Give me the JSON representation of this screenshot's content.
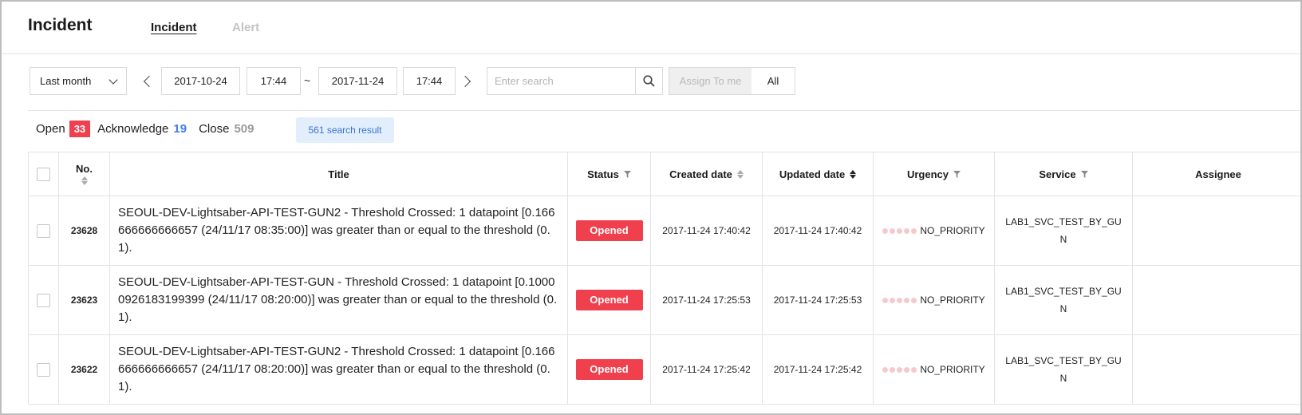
{
  "header": {
    "app_title": "Incident",
    "tabs": [
      {
        "label": "Incident",
        "active": true
      },
      {
        "label": "Alert",
        "active": false
      }
    ]
  },
  "filters": {
    "range": "Last month",
    "start_date": "2017-10-24",
    "start_time": "17:44",
    "separator": "~",
    "end_date": "2017-11-24",
    "end_time": "17:44",
    "search_placeholder": "Enter search",
    "assign_label": "Assign To me",
    "all_label": "All"
  },
  "counts": {
    "open_label": "Open",
    "open_value": "33",
    "ack_label": "Acknowledge",
    "ack_value": "19",
    "close_label": "Close",
    "close_value": "509",
    "result": "561 search result"
  },
  "colors": {
    "open_badge": "#f0404e",
    "ack_value": "#3f7ee8",
    "result_pill_bg": "#e2eefc",
    "status_opened": "#f0404e",
    "urgency_dot": "#f6c9cd"
  },
  "table": {
    "columns": {
      "no": "No.",
      "title": "Title",
      "status": "Status",
      "created": "Created date",
      "updated": "Updated date",
      "urgency": "Urgency",
      "service": "Service",
      "assignee": "Assignee"
    },
    "rows": [
      {
        "no": "23628",
        "title": "SEOUL-DEV-Lightsaber-API-TEST-GUN2 - Threshold Crossed: 1 datapoint [0.166666666666657 (24/11/17 08:35:00)] was greater than or equal to the threshold (0.1).",
        "status": "Opened",
        "created": "2017-11-24 17:40:42",
        "updated": "2017-11-24 17:40:42",
        "urgency": "NO_PRIORITY",
        "service": "LAB1_SVC_TEST_BY_GUN",
        "assignee": ""
      },
      {
        "no": "23623",
        "title": "SEOUL-DEV-Lightsaber-API-TEST-GUN - Threshold Crossed: 1 datapoint [0.10000926183199399 (24/11/17 08:20:00)] was greater than or equal to the threshold (0.1).",
        "status": "Opened",
        "created": "2017-11-24 17:25:53",
        "updated": "2017-11-24 17:25:53",
        "urgency": "NO_PRIORITY",
        "service": "LAB1_SVC_TEST_BY_GUN",
        "assignee": ""
      },
      {
        "no": "23622",
        "title": "SEOUL-DEV-Lightsaber-API-TEST-GUN2 - Threshold Crossed: 1 datapoint [0.166666666666657 (24/11/17 08:20:00)] was greater than or equal to the threshold (0.1).",
        "status": "Opened",
        "created": "2017-11-24 17:25:42",
        "updated": "2017-11-24 17:25:42",
        "urgency": "NO_PRIORITY",
        "service": "LAB1_SVC_TEST_BY_GUN",
        "assignee": ""
      }
    ]
  }
}
